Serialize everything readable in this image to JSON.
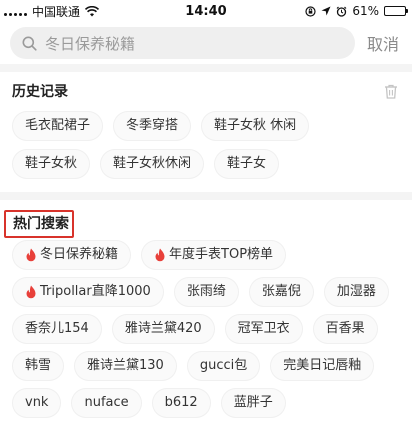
{
  "status_bar": {
    "carrier": "中国联通",
    "time": "14:40",
    "battery": "61%",
    "battery_level": 0.61
  },
  "search": {
    "placeholder": "冬日保养秘籍",
    "cancel_label": "取消"
  },
  "history": {
    "title": "历史记录",
    "items": [
      "毛衣配裙子",
      "冬季穿搭",
      "鞋子女秋 休闲",
      "鞋子女秋",
      "鞋子女秋休闲",
      "鞋子女"
    ]
  },
  "hot": {
    "title": "热门搜索",
    "highlight_color": "#d8332b",
    "items": [
      {
        "label": "冬日保养秘籍",
        "hot": true
      },
      {
        "label": "年度手表TOP榜单",
        "hot": true
      },
      {
        "label": "Tripollar直降1000",
        "hot": true
      },
      {
        "label": "张雨绮",
        "hot": false
      },
      {
        "label": "张嘉倪",
        "hot": false
      },
      {
        "label": "加湿器",
        "hot": false
      },
      {
        "label": "香奈儿154",
        "hot": false
      },
      {
        "label": "雅诗兰黛420",
        "hot": false
      },
      {
        "label": "冠军卫衣",
        "hot": false
      },
      {
        "label": "百香果",
        "hot": false
      },
      {
        "label": "韩雪",
        "hot": false
      },
      {
        "label": "雅诗兰黛130",
        "hot": false
      },
      {
        "label": "gucci包",
        "hot": false
      },
      {
        "label": "完美日记唇釉",
        "hot": false
      },
      {
        "label": "vnk",
        "hot": false
      },
      {
        "label": "nuface",
        "hot": false
      },
      {
        "label": "b612",
        "hot": false
      },
      {
        "label": "蓝胖子",
        "hot": false
      }
    ]
  },
  "icons": {
    "search": "search-icon",
    "trash": "trash-icon",
    "fire": "fire-icon",
    "wifi": "wifi-icon",
    "location": "location-icon",
    "alarm": "alarm-clock-icon",
    "lock": "rotation-lock-icon"
  }
}
